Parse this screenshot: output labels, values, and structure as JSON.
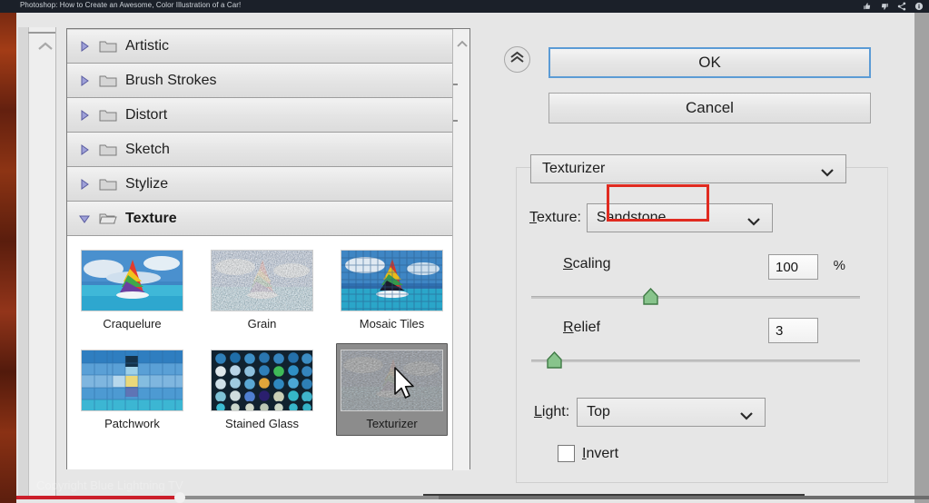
{
  "titlebar": {
    "title": "Photoshop: How to Create an Awesome, Color Illustration of a Car!",
    "icons": [
      "thumbs-up-icon",
      "thumbs-down-icon",
      "share-icon",
      "more-info-icon"
    ]
  },
  "gallery": {
    "categories": [
      {
        "label": "Artistic",
        "expanded": false
      },
      {
        "label": "Brush Strokes",
        "expanded": false
      },
      {
        "label": "Distort",
        "expanded": false
      },
      {
        "label": "Sketch",
        "expanded": false
      },
      {
        "label": "Stylize",
        "expanded": false
      },
      {
        "label": "Texture",
        "expanded": true
      }
    ],
    "thumbnails": [
      [
        {
          "name": "Craquelure",
          "selected": false
        },
        {
          "name": "Grain",
          "selected": false
        },
        {
          "name": "Mosaic Tiles",
          "selected": false
        }
      ],
      [
        {
          "name": "Patchwork",
          "selected": false
        },
        {
          "name": "Stained Glass",
          "selected": false
        },
        {
          "name": "Texturizer",
          "selected": true
        }
      ]
    ]
  },
  "controls": {
    "ok_label": "OK",
    "cancel_label": "Cancel",
    "filter_select_value": "Texturizer",
    "texture_label": "Texture:",
    "texture_value": "Sandstone",
    "scaling_label": "Scaling",
    "scaling_value": "100",
    "scaling_unit": "%",
    "relief_label": "Relief",
    "relief_value": "3",
    "light_label": "Light:",
    "light_value": "Top",
    "invert_label": "Invert",
    "invert_checked": false
  },
  "annotation": {
    "highlight_color": "#e02b20",
    "highlight_target": "texture-value-dropdown"
  },
  "overlay": {
    "watermark": "Copyright Blue Lightning TV"
  }
}
